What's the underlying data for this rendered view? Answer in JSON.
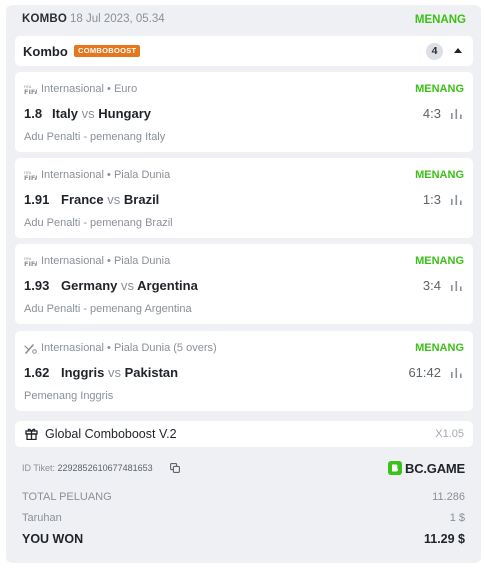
{
  "header": {
    "label": "KOMBO",
    "date": "18 Jul 2023, 05.34",
    "status": "MENANG",
    "status_color": "#3bc117"
  },
  "kombo_bar": {
    "title": "Kombo",
    "badge": "COMBOBOOST",
    "badge_color": "#e5771f",
    "count": "4",
    "toggle_icon": "caret-up-icon"
  },
  "bets": [
    {
      "sport_icon": "fifa-icon",
      "league": "Internasional • Euro",
      "result": "MENANG",
      "odds": "1.8",
      "home": "Italy",
      "vs": "vs",
      "away": "Hungary",
      "score": "4:3",
      "market": "Adu Penalti - pemenang Italy"
    },
    {
      "sport_icon": "fifa-icon",
      "league": "Internasional • Piala Dunia",
      "result": "MENANG",
      "odds": "1.91",
      "home": "France",
      "vs": "vs",
      "away": "Brazil",
      "score": "1:3",
      "market": "Adu Penalti - pemenang Brazil"
    },
    {
      "sport_icon": "fifa-icon",
      "league": "Internasional • Piala Dunia",
      "result": "MENANG",
      "odds": "1.93",
      "home": "Germany",
      "vs": "vs",
      "away": "Argentina",
      "score": "3:4",
      "market": "Adu Penalti - pemenang Argentina"
    },
    {
      "sport_icon": "cricket-icon",
      "league": "Internasional • Piala Dunia (5 overs)",
      "result": "MENANG",
      "odds": "1.62",
      "home": "Inggris",
      "vs": "vs",
      "away": "Pakistan",
      "score": "61:42",
      "market": "Pemenang Inggris"
    }
  ],
  "global_boost": {
    "icon": "gift-icon",
    "label": "Global Comboboost V.2",
    "multiplier": "X1.05"
  },
  "footer": {
    "ticket_label": "ID Tiket:",
    "ticket_id": "2292852610677481653",
    "brand": "BC.GAME",
    "brand_color": "#3bc117",
    "total_odds_label": "TOTAL PELUANG",
    "total_odds": "11.286",
    "stake_label": "Taruhan",
    "stake": "1 $",
    "won_label": "YOU WON",
    "won": "11.29 $"
  }
}
